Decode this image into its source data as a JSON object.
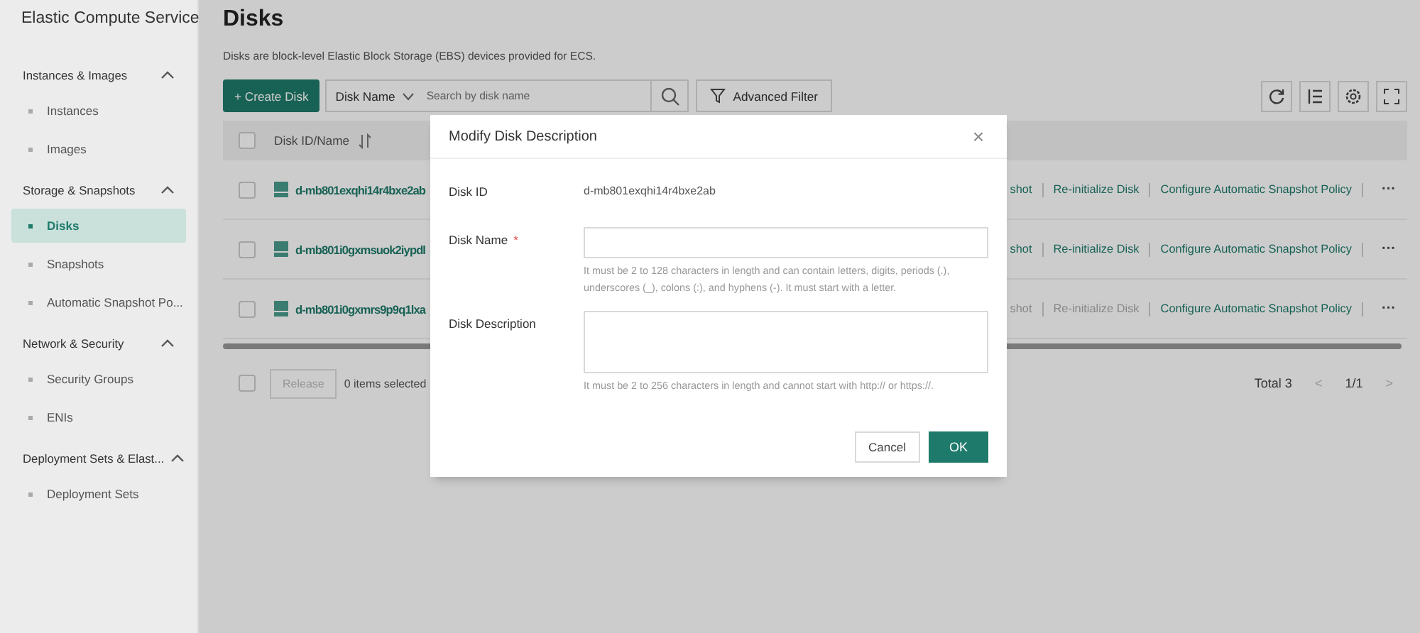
{
  "sidebar": {
    "title": "Elastic Compute Service",
    "groups": [
      {
        "label": "Instances & Images",
        "expanded": true,
        "items": [
          {
            "label": "Instances",
            "selected": false
          },
          {
            "label": "Images",
            "selected": false
          }
        ]
      },
      {
        "label": "Storage & Snapshots",
        "expanded": true,
        "items": [
          {
            "label": "Disks",
            "selected": true
          },
          {
            "label": "Snapshots",
            "selected": false
          },
          {
            "label": "Automatic Snapshot Po...",
            "selected": false
          }
        ]
      },
      {
        "label": "Network & Security",
        "expanded": true,
        "items": [
          {
            "label": "Security Groups",
            "selected": false
          },
          {
            "label": "ENIs",
            "selected": false
          }
        ]
      },
      {
        "label": "Deployment Sets & Elast...",
        "expanded": true,
        "items": [
          {
            "label": "Deployment Sets",
            "selected": false
          }
        ]
      }
    ]
  },
  "page": {
    "title": "Disks",
    "description": "Disks are block-level Elastic Block Storage (EBS) devices provided for ECS."
  },
  "toolbar": {
    "create_button": "+ Create Disk",
    "search_by": "Disk Name",
    "search_placeholder": "Search by disk name",
    "filter_button": "Advanced Filter"
  },
  "table": {
    "select_all_checked": false,
    "columns": [
      "Disk ID/Name"
    ],
    "rows": [
      {
        "id": "d-mb801exqhi14r4bxe2ab",
        "checked": false,
        "actions": [
          {
            "label": "shot",
            "disabled": false
          },
          {
            "label": "Re-initialize Disk",
            "disabled": false
          },
          {
            "label": "Configure Automatic Snapshot Policy",
            "disabled": false
          }
        ],
        "more": "···"
      },
      {
        "id": "d-mb801i0gxmsuok2iypdl",
        "checked": false,
        "actions": [
          {
            "label": "shot",
            "disabled": false
          },
          {
            "label": "Re-initialize Disk",
            "disabled": false
          },
          {
            "label": "Configure Automatic Snapshot Policy",
            "disabled": false
          }
        ],
        "more": "···"
      },
      {
        "id": "d-mb801i0gxmrs9p9q1lxa",
        "checked": false,
        "actions": [
          {
            "label": "shot",
            "disabled": true
          },
          {
            "label": "Re-initialize Disk",
            "disabled": true
          },
          {
            "label": "Configure Automatic Snapshot Policy",
            "disabled": false
          }
        ],
        "more": "···"
      }
    ]
  },
  "footer": {
    "checked": false,
    "release_button": "Release",
    "selected_count": "0 items selected",
    "total": "Total 3",
    "page": "1/1",
    "prev": "<",
    "next": ">"
  },
  "dialog": {
    "title": "Modify Disk Description",
    "close": "×",
    "fields": [
      {
        "kind": "static",
        "label": "Disk ID",
        "value": "d-mb801exqhi14r4bxe2ab"
      },
      {
        "kind": "input",
        "label": "Disk Name",
        "required": true,
        "required_mark": "*",
        "hint": "It must be 2 to 128 characters in length and can contain letters, digits, periods (.), underscores (_), colons (:), and hyphens (-). It must start with a letter."
      },
      {
        "kind": "textarea",
        "label": "Disk Description",
        "hint": "It must be 2 to 256 characters in length and cannot start with http:// or https://."
      }
    ],
    "cancel": "Cancel",
    "ok": "OK"
  }
}
